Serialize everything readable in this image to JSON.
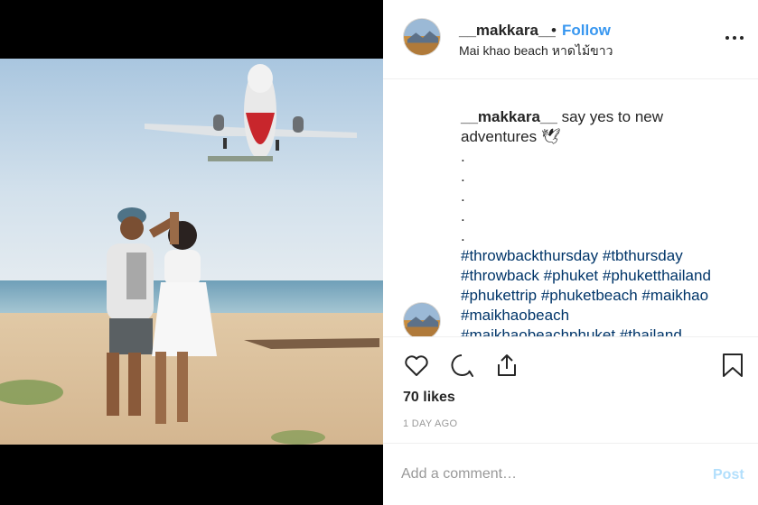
{
  "post": {
    "username": "__makkara__",
    "separator": "•",
    "follow_label": "Follow",
    "location": "Mai khao beach หาดไม้ขาว",
    "more_icon": "more-horizontal-icon"
  },
  "caption": {
    "username": "__makkara__",
    "text_line1": "say yes to new",
    "text_line2": "adventures 🕊",
    "dots": [
      ".",
      ".",
      ".",
      ".",
      "."
    ],
    "hashtag_lines": [
      "#throwbackthursday #tbthursday",
      "#throwback #phuket #phuketthailand",
      "#phukettrip #phuketbeach #maikhao",
      "#maikhaobeach",
      "#maikhaobeachphuket #thailand"
    ]
  },
  "actions": {
    "like_icon": "heart-icon",
    "comment_icon": "comment-icon",
    "share_icon": "share-icon",
    "save_icon": "bookmark-icon"
  },
  "likes": "70 likes",
  "timestamp": "1 DAY AGO",
  "comment_box": {
    "placeholder": "Add a comment…",
    "post_label": "Post"
  },
  "colors": {
    "link_blue": "#3897f0",
    "hashtag": "#003569",
    "post_disabled": "#b2dffc"
  }
}
